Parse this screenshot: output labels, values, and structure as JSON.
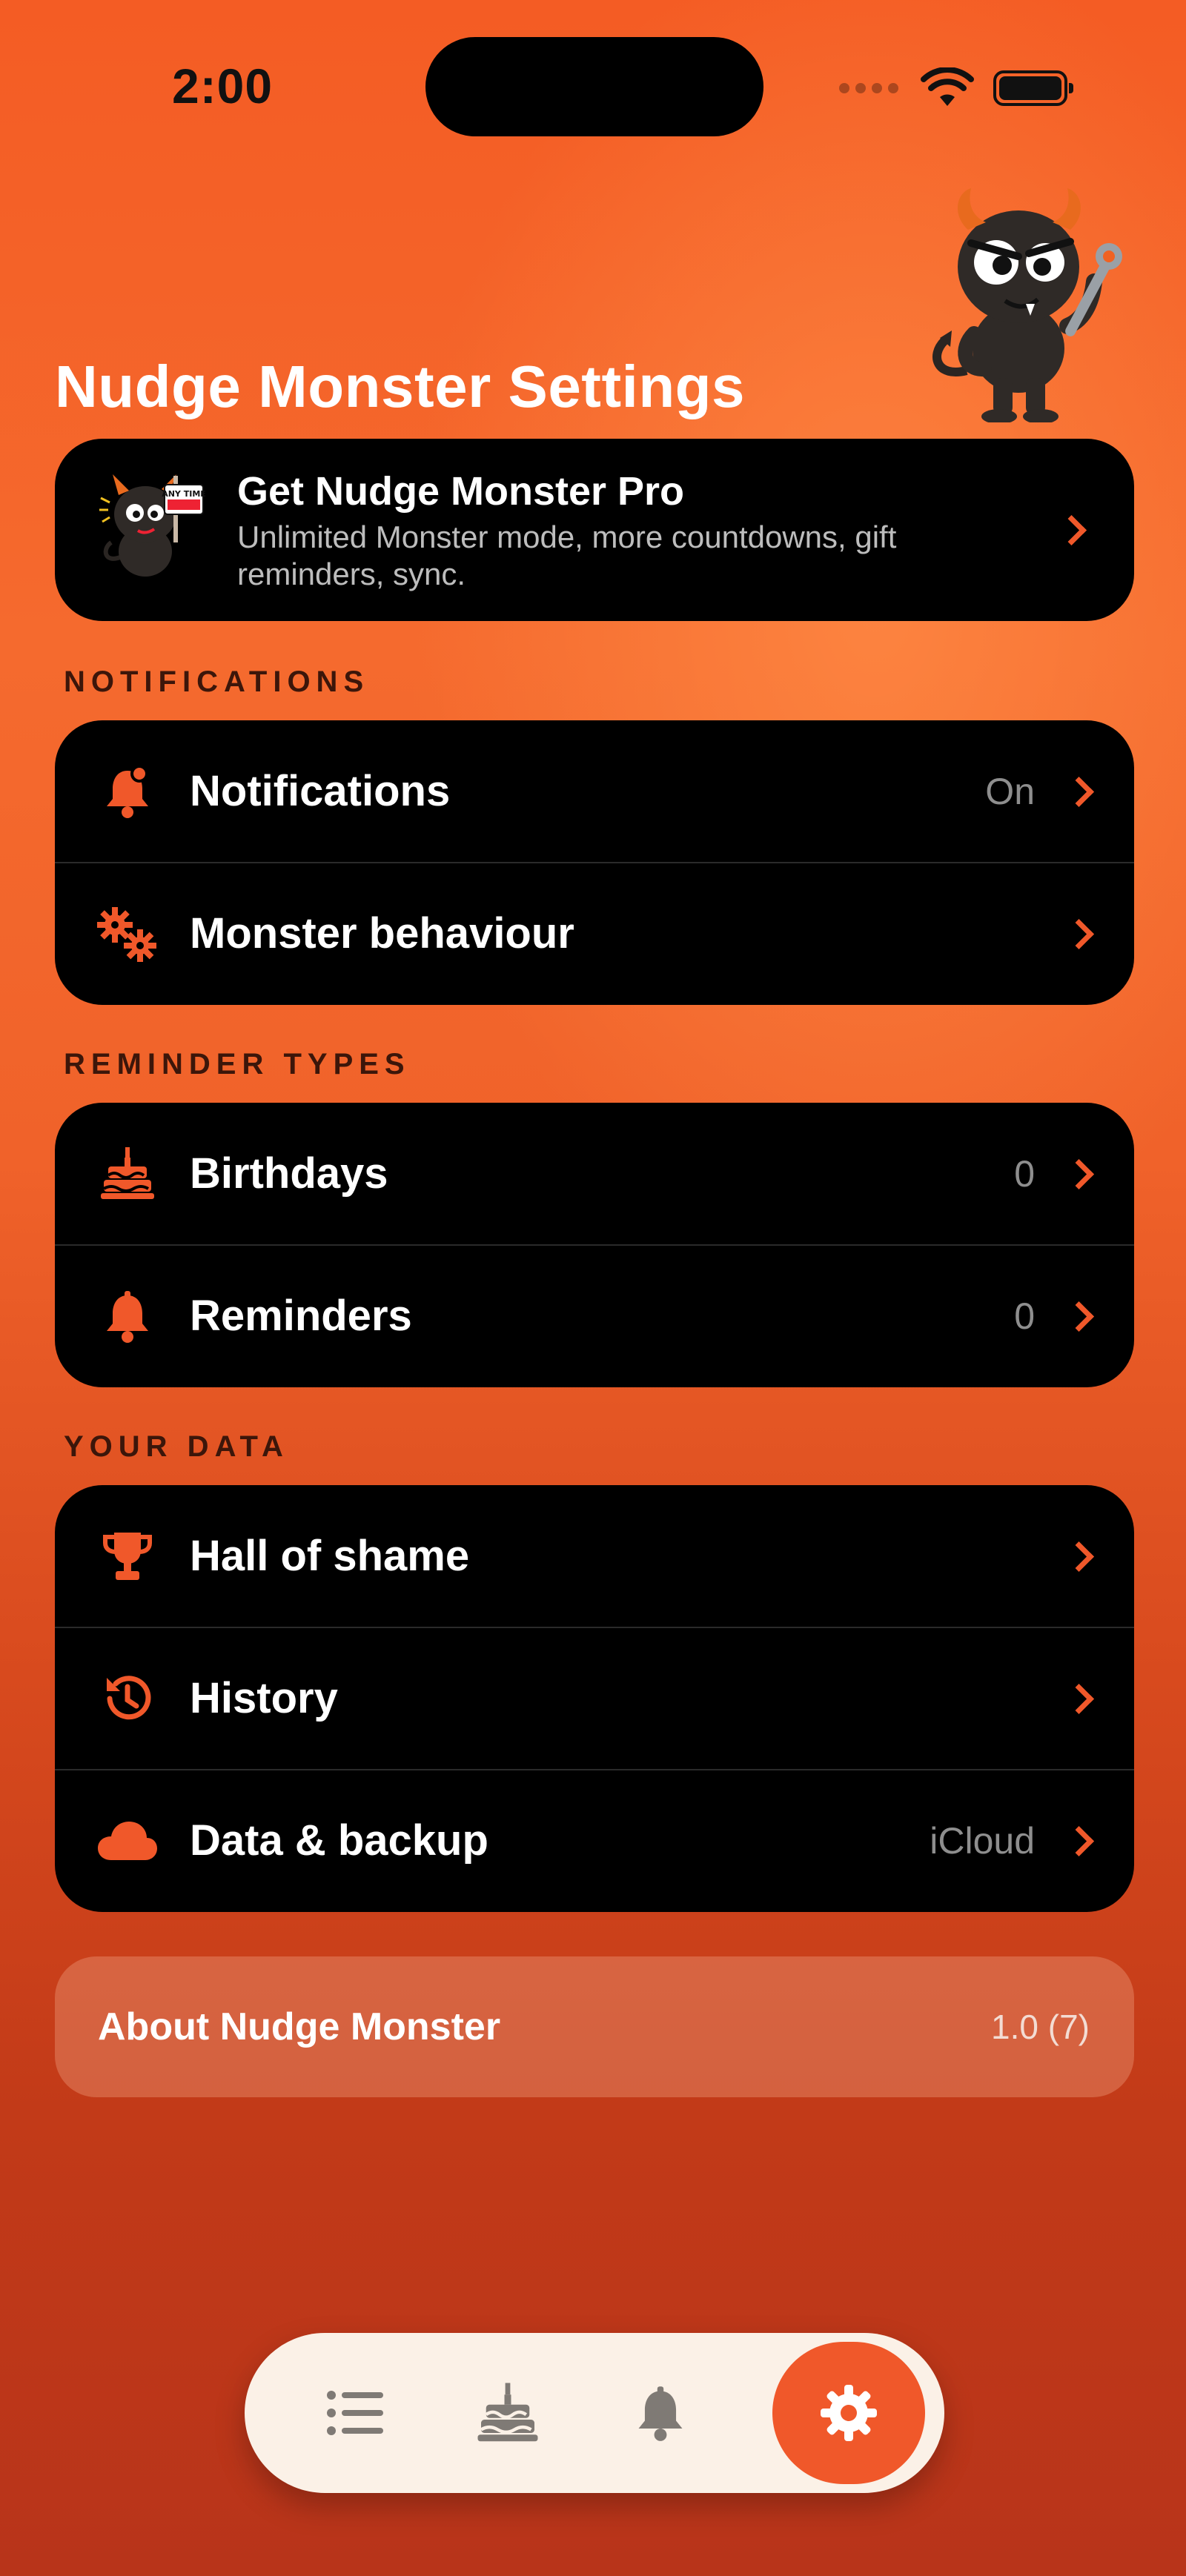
{
  "status_bar": {
    "time": "2:00"
  },
  "title": "Nudge Monster Settings",
  "pro": {
    "title": "Get Nudge Monster Pro",
    "subtitle": "Unlimited Monster mode, more countdowns, gift reminders, sync.",
    "sign_text": "ANY TIME"
  },
  "sections": {
    "notifications": {
      "header": "NOTIFICATIONS",
      "rows": [
        {
          "label": "Notifications",
          "value": "On",
          "icon": "bell-badge-icon"
        },
        {
          "label": "Monster behaviour",
          "value": "",
          "icon": "gears-icon"
        }
      ]
    },
    "reminder_types": {
      "header": "REMINDER TYPES",
      "rows": [
        {
          "label": "Birthdays",
          "value": "0",
          "icon": "cake-icon"
        },
        {
          "label": "Reminders",
          "value": "0",
          "icon": "bell-icon"
        }
      ]
    },
    "your_data": {
      "header": "YOUR DATA",
      "rows": [
        {
          "label": "Hall of shame",
          "value": "",
          "icon": "trophy-icon"
        },
        {
          "label": "History",
          "value": "",
          "icon": "history-icon"
        },
        {
          "label": "Data & backup",
          "value": "iCloud",
          "icon": "cloud-icon"
        }
      ]
    }
  },
  "about": {
    "label": "About Nudge Monster",
    "version": "1.0 (7)"
  },
  "tab_bar": {
    "tabs": [
      {
        "name": "list",
        "icon": "list-icon"
      },
      {
        "name": "birthdays",
        "icon": "cake-icon"
      },
      {
        "name": "reminders",
        "icon": "bell-icon"
      },
      {
        "name": "settings",
        "icon": "gear-icon",
        "active": true
      }
    ]
  },
  "colors": {
    "accent": "#f0582a",
    "card_bg": "#000000",
    "section_header": "#3c160a",
    "tab_bar_bg": "#fbf1e7"
  }
}
